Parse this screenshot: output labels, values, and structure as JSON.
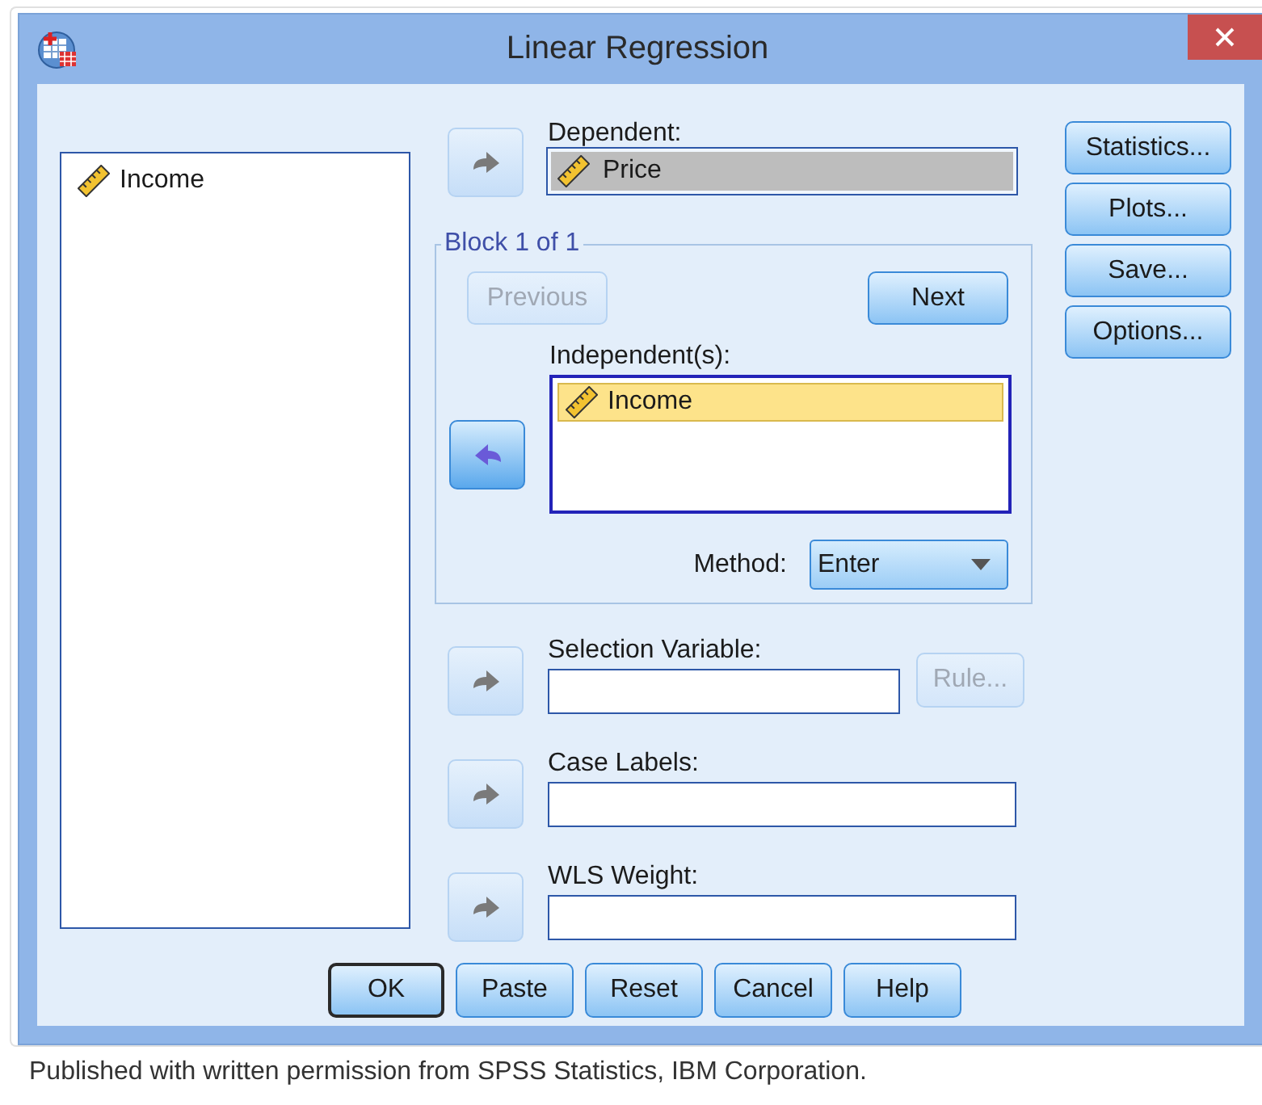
{
  "window": {
    "title": "Linear Regression"
  },
  "variables": [
    {
      "name": "Income",
      "selected": false
    }
  ],
  "dependent": {
    "label": "Dependent:",
    "value": "Price",
    "arrow": {
      "kind": "add",
      "disabled": true
    }
  },
  "block": {
    "title": "Block 1 of 1",
    "previous": {
      "label": "Previous",
      "disabled": true
    },
    "next": {
      "label": "Next",
      "disabled": false
    },
    "independents_label": "Independent(s):",
    "arrow": {
      "kind": "remove",
      "disabled": false
    },
    "independents": [
      {
        "name": "Income",
        "selected": true
      }
    ],
    "method_label": "Method:",
    "method": "Enter"
  },
  "selection_variable": {
    "label": "Selection Variable:",
    "arrow": {
      "kind": "add",
      "disabled": true
    },
    "rule": {
      "label": "Rule...",
      "disabled": true
    }
  },
  "case_labels": {
    "label": "Case Labels:",
    "arrow": {
      "kind": "add",
      "disabled": true
    }
  },
  "wls_weight": {
    "label": "WLS Weight:",
    "arrow": {
      "kind": "add",
      "disabled": true
    }
  },
  "side_buttons": [
    {
      "label": "Statistics..."
    },
    {
      "label": "Plots..."
    },
    {
      "label": "Save..."
    },
    {
      "label": "Options..."
    }
  ],
  "buttons": [
    {
      "label": "OK",
      "default": true
    },
    {
      "label": "Paste",
      "default": false
    },
    {
      "label": "Reset",
      "default": false
    },
    {
      "label": "Cancel",
      "default": false
    },
    {
      "label": "Help",
      "default": false
    }
  ],
  "caption": "Published with written permission from SPSS Statistics, IBM Corporation."
}
